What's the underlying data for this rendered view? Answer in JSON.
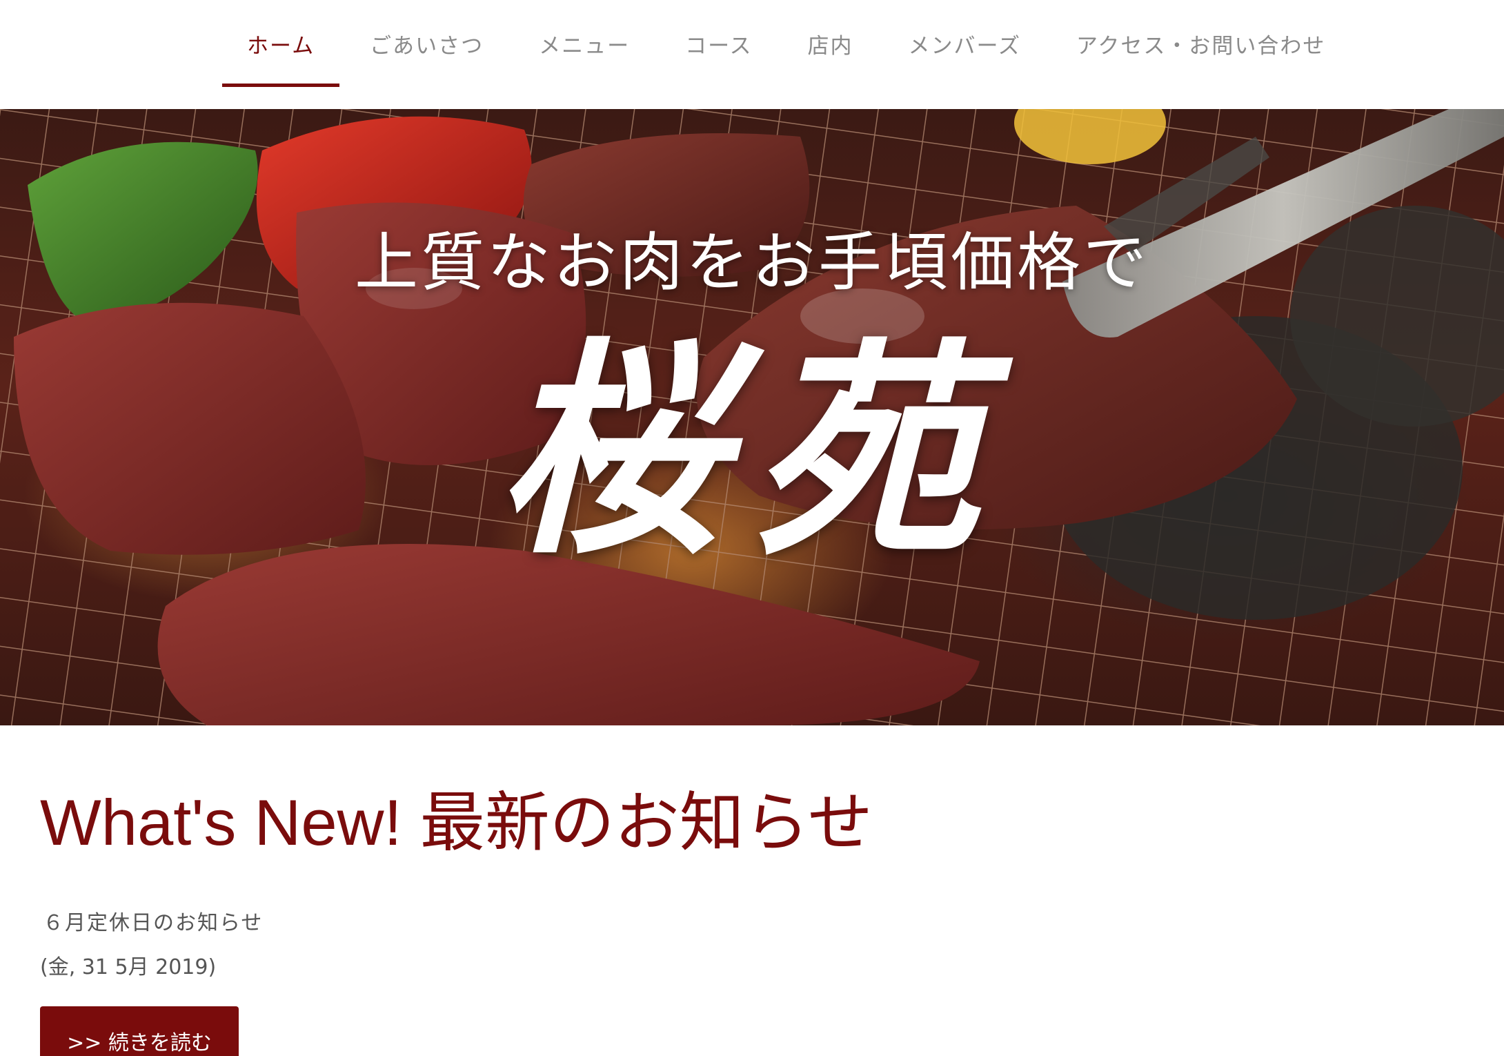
{
  "nav": {
    "items": [
      {
        "label": "ホーム",
        "active": true
      },
      {
        "label": "ごあいさつ",
        "active": false
      },
      {
        "label": "メニュー",
        "active": false
      },
      {
        "label": "コース",
        "active": false
      },
      {
        "label": "店内",
        "active": false
      },
      {
        "label": "メンバーズ",
        "active": false
      },
      {
        "label": "アクセス・お問い合わせ",
        "active": false
      }
    ]
  },
  "hero": {
    "tagline": "上質なお肉をお手頃価格で",
    "logo_text": "桜苑"
  },
  "news": {
    "heading": "What's New! 最新のお知らせ",
    "items": [
      {
        "title": "６月定休日のお知らせ",
        "date": "(金, 31 5月 2019)",
        "read_more_label": ">> 続きを読む"
      }
    ]
  },
  "colors": {
    "accent": "#7a0c0c",
    "nav_text": "#8a8a8a",
    "body_text": "#555555"
  }
}
